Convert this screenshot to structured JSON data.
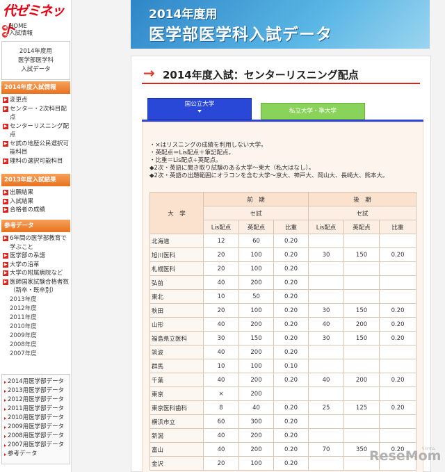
{
  "sidebar": {
    "logo": "代ゼミネット",
    "home_link": "HOME",
    "exam_info_link": "入試情報",
    "box_title": [
      "2014年度用",
      "医学部医学科",
      "入試データ"
    ],
    "section1": {
      "heading": "2014年度入試情報",
      "items": [
        {
          "label": "変更点"
        },
        {
          "label": "センター・2次科目配点"
        },
        {
          "label": "センターリスニング配点"
        },
        {
          "label": "セ試の地歴公民選択可能科目"
        },
        {
          "label": "理科の選択可能科目"
        }
      ]
    },
    "section2": {
      "heading": "2013年度入試結果",
      "items": [
        {
          "label": "出願結果"
        },
        {
          "label": "入試結果"
        },
        {
          "label": "合格者の成績"
        }
      ]
    },
    "section3": {
      "heading": "参考データ",
      "items": [
        {
          "label": "6年間の医学部教育で学ぶこと"
        },
        {
          "label": "医学部の系譜"
        },
        {
          "label": "大学の沿革"
        },
        {
          "label": "大学の附属病院など"
        },
        {
          "label": "医師国家試験合格者数（新卒・既卒別）"
        }
      ],
      "years": [
        "2013年度",
        "2012年度",
        "2011年度",
        "2010年度",
        "2009年度",
        "2008年度",
        "2007年度"
      ]
    },
    "year_links": [
      "2014用医学部データ",
      "2013用医学部データ",
      "2012用医学部データ",
      "2011用医学部データ",
      "2010用医学部データ",
      "2009用医学部データ",
      "2008用医学部データ",
      "2007用医学部データ",
      "参考データ"
    ]
  },
  "banner": {
    "line1": "2014年度用",
    "line2": "医学部医学科入試データ"
  },
  "main": {
    "section_title": "2014年度入試：センターリスニング配点",
    "tabs": [
      {
        "label": "国公立大学",
        "active": true
      },
      {
        "label": "私立大学・準大学",
        "active": false
      }
    ],
    "notes": [
      "・×はリスニングの成績を利用しない大学。",
      "・英配点＝Lis配点＋筆記配点。",
      "・比重＝Lis配点÷英配点。",
      "◆2次・英語に聞き取り試験のある大学〜東大（私大はなし）。",
      "◆2次・英語の出題範囲にオラコンを含む大学〜京大、神戸大、岡山大、長崎大、熊本大。"
    ],
    "table": {
      "col_university": "大　学",
      "zenki": "前　期",
      "kouki": "後　期",
      "seshi": "セ試",
      "sub_headers": [
        "Lis配点",
        "英配点",
        "比重"
      ],
      "rows": [
        {
          "name": "北海道",
          "v": [
            "12",
            "60",
            "0.20",
            "",
            "",
            ""
          ]
        },
        {
          "name": "旭川医科",
          "v": [
            "20",
            "100",
            "0.20",
            "30",
            "150",
            "0.20"
          ]
        },
        {
          "name": "札幌医科",
          "v": [
            "20",
            "100",
            "0.20",
            "",
            "",
            ""
          ]
        },
        {
          "name": "弘前",
          "v": [
            "40",
            "200",
            "0.20",
            "",
            "",
            ""
          ]
        },
        {
          "name": "東北",
          "v": [
            "10",
            "50",
            "0.20",
            "",
            "",
            ""
          ]
        },
        {
          "name": "秋田",
          "v": [
            "20",
            "100",
            "0.20",
            "30",
            "150",
            "0.20"
          ]
        },
        {
          "name": "山形",
          "v": [
            "40",
            "200",
            "0.20",
            "40",
            "200",
            "0.20"
          ]
        },
        {
          "name": "福島県立医科",
          "v": [
            "30",
            "150",
            "0.20",
            "30",
            "150",
            "0.20"
          ]
        },
        {
          "name": "筑波",
          "v": [
            "40",
            "200",
            "0.20",
            "",
            "",
            ""
          ]
        },
        {
          "name": "群馬",
          "v": [
            "10",
            "100",
            "0.10",
            "",
            "",
            ""
          ]
        },
        {
          "name": "千葉",
          "v": [
            "40",
            "200",
            "0.20",
            "40",
            "200",
            "0.20"
          ]
        },
        {
          "name": "東京",
          "v": [
            "×",
            "200",
            "",
            "",
            "",
            ""
          ]
        },
        {
          "name": "東京医科歯科",
          "v": [
            "8",
            "40",
            "0.20",
            "25",
            "125",
            "0.20"
          ]
        },
        {
          "name": "横浜市立",
          "v": [
            "60",
            "300",
            "0.20",
            "",
            "",
            ""
          ]
        },
        {
          "name": "新潟",
          "v": [
            "40",
            "200",
            "0.20",
            "",
            "",
            ""
          ]
        },
        {
          "name": "富山",
          "v": [
            "40",
            "200",
            "0.20",
            "70",
            "350",
            "0.20"
          ]
        },
        {
          "name": "金沢",
          "v": [
            "20",
            "100",
            "0.20",
            "",
            "",
            ""
          ]
        }
      ]
    }
  },
  "watermark": {
    "text_a": "Rese",
    "text_b": "Mom",
    "sub": "リセマム"
  }
}
